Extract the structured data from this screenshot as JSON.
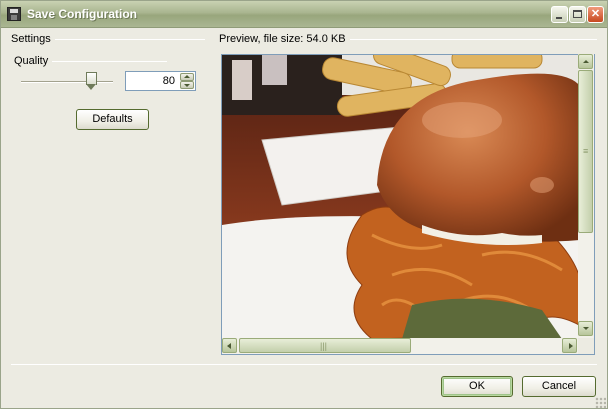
{
  "window": {
    "title": "Save Configuration",
    "accent_color": "#a9b58f"
  },
  "settings": {
    "group_label": "Settings",
    "quality_label": "Quality",
    "quality_value": "80",
    "quality_slider_fraction": 0.8,
    "defaults_button": "Defaults"
  },
  "preview": {
    "group_label": "Preview, file size: 54.0 KB",
    "image_description_icon": "burger-photo"
  },
  "footer": {
    "ok_button": "OK",
    "cancel_button": "Cancel"
  },
  "icons": {
    "title_icon": "floppy-disk-icon",
    "minimize": "minimize-icon",
    "maximize": "maximize-icon",
    "close": "close-icon"
  }
}
